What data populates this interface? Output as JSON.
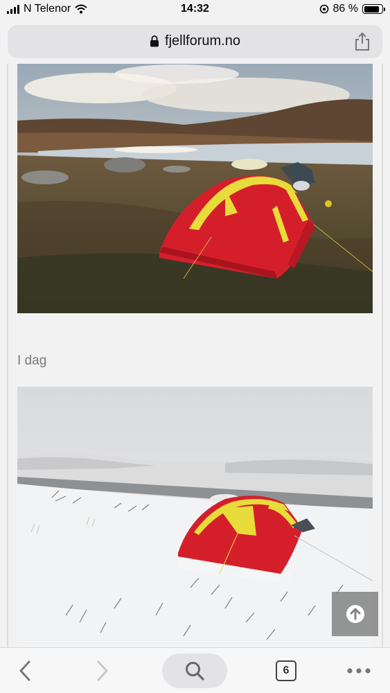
{
  "status_bar": {
    "carrier": "N Telenor",
    "time": "14:32",
    "battery_percent": "86 %",
    "battery_level": 0.86
  },
  "browser": {
    "url": "fjellforum.no",
    "tab_count": "6"
  },
  "page": {
    "section_label": "I dag"
  },
  "colors": {
    "tent_red": "#d41f2b",
    "tent_yellow": "#e8dc3a",
    "accent_gray": "#828282"
  },
  "icons": {
    "lock": "lock-icon",
    "share": "share-icon",
    "back": "chevron-left-icon",
    "forward": "chevron-right-icon",
    "search": "search-icon",
    "more": "more-dots-icon",
    "scroll_top": "arrow-up-icon"
  }
}
